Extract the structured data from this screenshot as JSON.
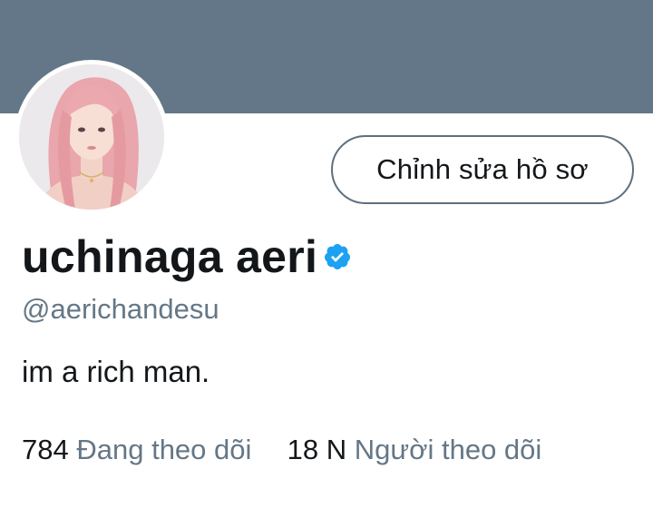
{
  "profile": {
    "display_name": "uchinaga aeri",
    "handle": "@aerichandesu",
    "bio": "im a rich man.",
    "verified": true,
    "edit_button_label": "Chỉnh sửa hồ sơ",
    "following_count": "784",
    "following_label": "Đang theo dõi",
    "followers_count": "18 N",
    "followers_label": "Người theo dõi"
  },
  "colors": {
    "banner": "#647788",
    "verified_badge": "#1da1f2",
    "primary_text": "#14171a",
    "secondary_text": "#657786"
  },
  "icons": {
    "verified": "verified-badge-icon",
    "avatar": "profile-photo"
  }
}
